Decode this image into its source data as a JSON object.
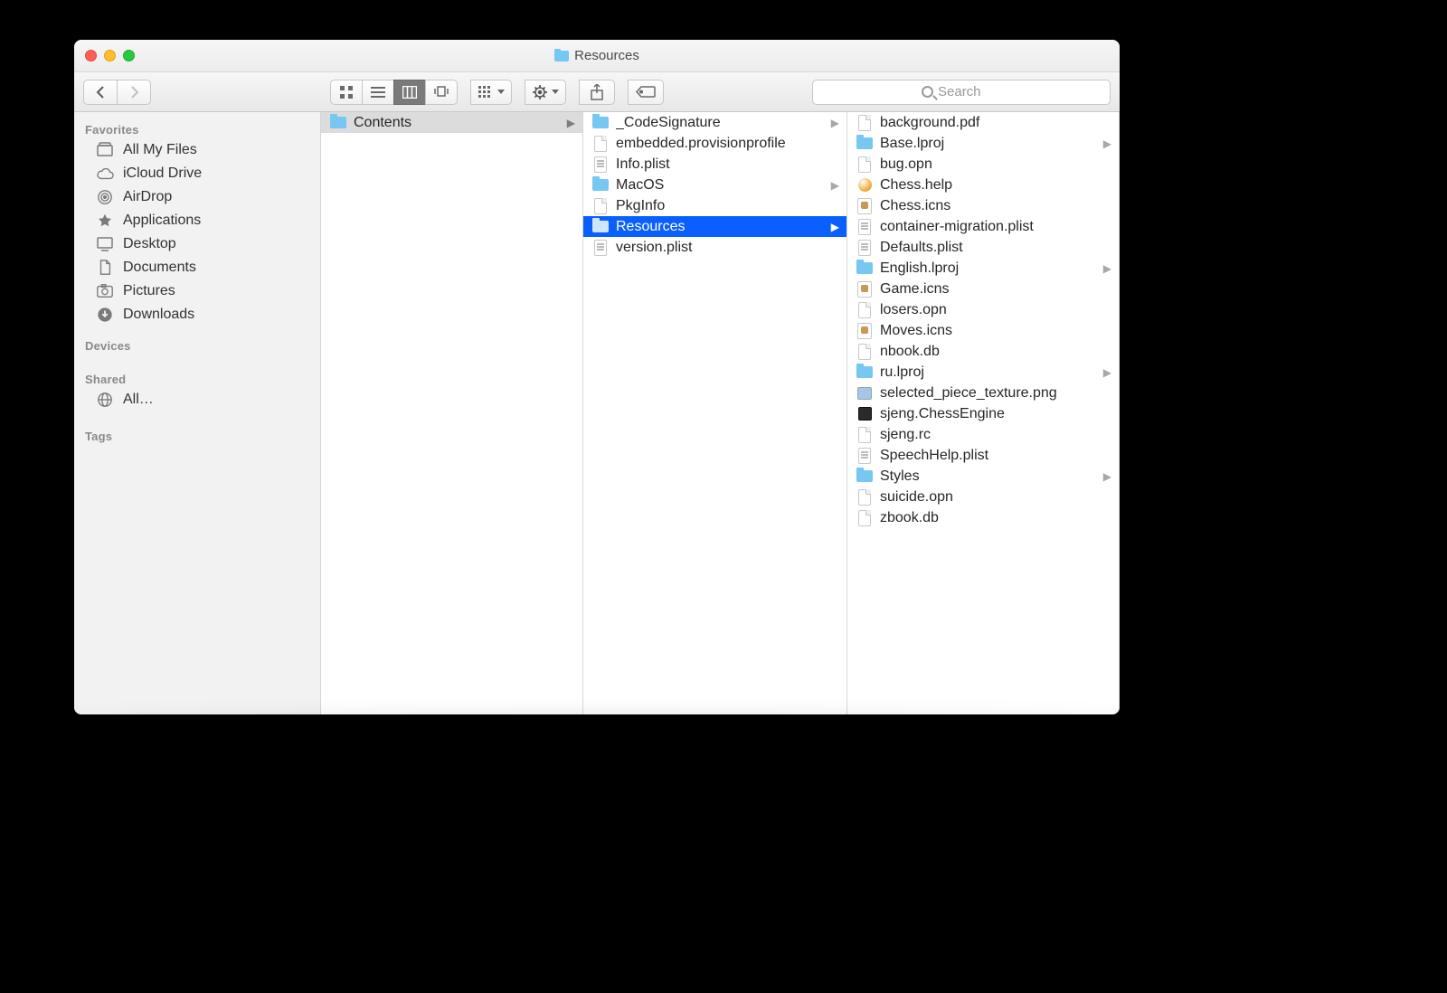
{
  "window": {
    "title": "Resources"
  },
  "search": {
    "placeholder": "Search"
  },
  "sidebar": {
    "favorites_label": "Favorites",
    "favorites": [
      {
        "label": "All My Files",
        "icon": "all-my-files"
      },
      {
        "label": "iCloud Drive",
        "icon": "icloud"
      },
      {
        "label": "AirDrop",
        "icon": "airdrop"
      },
      {
        "label": "Applications",
        "icon": "applications"
      },
      {
        "label": "Desktop",
        "icon": "desktop"
      },
      {
        "label": "Documents",
        "icon": "documents"
      },
      {
        "label": "Pictures",
        "icon": "pictures"
      },
      {
        "label": "Downloads",
        "icon": "downloads"
      }
    ],
    "devices_label": "Devices",
    "shared_label": "Shared",
    "shared": [
      {
        "label": "All…",
        "icon": "globe"
      }
    ],
    "tags_label": "Tags"
  },
  "columns": {
    "col1": [
      {
        "name": "Contents",
        "type": "folder",
        "has_children": true,
        "selected": "grey"
      }
    ],
    "col2": [
      {
        "name": "_CodeSignature",
        "type": "folder",
        "has_children": true
      },
      {
        "name": "embedded.provisionprofile",
        "type": "file"
      },
      {
        "name": "Info.plist",
        "type": "plist"
      },
      {
        "name": "MacOS",
        "type": "folder",
        "has_children": true
      },
      {
        "name": "PkgInfo",
        "type": "file"
      },
      {
        "name": "Resources",
        "type": "folder",
        "has_children": true,
        "selected": "blue"
      },
      {
        "name": "version.plist",
        "type": "plist"
      }
    ],
    "col3": [
      {
        "name": "background.pdf",
        "type": "file"
      },
      {
        "name": "Base.lproj",
        "type": "folder",
        "has_children": true
      },
      {
        "name": "bug.opn",
        "type": "file"
      },
      {
        "name": "Chess.help",
        "type": "help"
      },
      {
        "name": "Chess.icns",
        "type": "icns"
      },
      {
        "name": "container-migration.plist",
        "type": "plist"
      },
      {
        "name": "Defaults.plist",
        "type": "plist"
      },
      {
        "name": "English.lproj",
        "type": "folder",
        "has_children": true
      },
      {
        "name": "Game.icns",
        "type": "icns"
      },
      {
        "name": "losers.opn",
        "type": "file"
      },
      {
        "name": "Moves.icns",
        "type": "icns"
      },
      {
        "name": "nbook.db",
        "type": "file"
      },
      {
        "name": "ru.lproj",
        "type": "folder",
        "has_children": true
      },
      {
        "name": "selected_piece_texture.png",
        "type": "img"
      },
      {
        "name": "sjeng.ChessEngine",
        "type": "exec"
      },
      {
        "name": "sjeng.rc",
        "type": "file"
      },
      {
        "name": "SpeechHelp.plist",
        "type": "plist"
      },
      {
        "name": "Styles",
        "type": "folder",
        "has_children": true
      },
      {
        "name": "suicide.opn",
        "type": "file"
      },
      {
        "name": "zbook.db",
        "type": "file"
      }
    ]
  }
}
